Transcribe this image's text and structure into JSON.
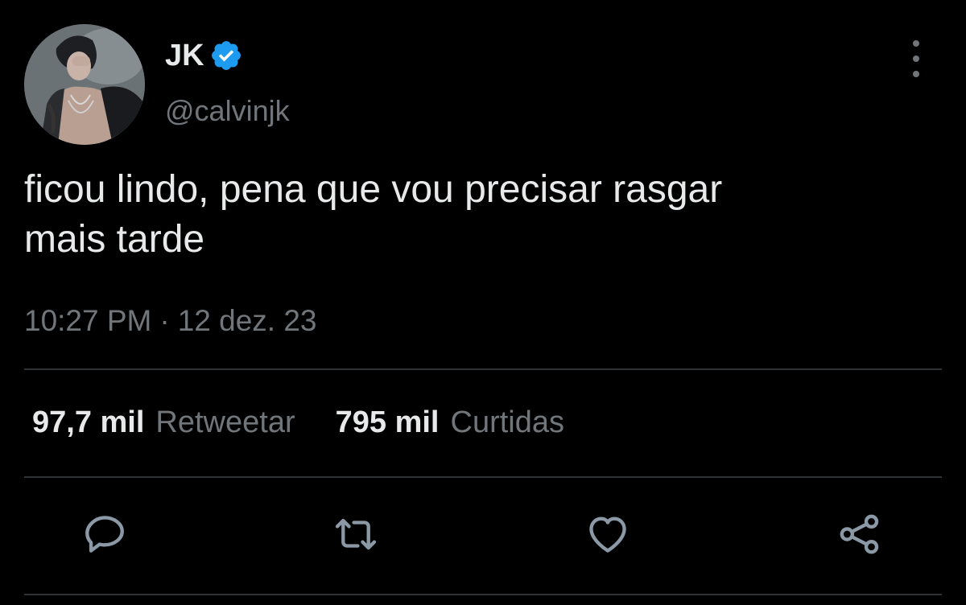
{
  "author": {
    "display_name": "JK",
    "handle": "@calvinjk",
    "verified_icon": "verified-badge-icon",
    "verified_color": "#1d9bf0"
  },
  "tweet": {
    "text": "ficou lindo, pena que vou precisar rasgar\nmais tarde",
    "time": "10:27 PM",
    "separator": "·",
    "date": "12 dez. 23"
  },
  "stats": {
    "retweets_count": "97,7 mil",
    "retweets_label": "Retweetar",
    "likes_count": "795 mil",
    "likes_label": "Curtidas"
  },
  "actions": {
    "reply_icon": "reply-icon",
    "retweet_icon": "retweet-icon",
    "like_icon": "heart-icon",
    "share_icon": "share-icon"
  },
  "menu": {
    "more_icon": "more-vertical-icon"
  },
  "colors": {
    "background": "#000000",
    "text_primary": "#e7e9ea",
    "text_secondary": "#71767b",
    "divider": "#2f3336",
    "icon": "#8b98a5"
  }
}
